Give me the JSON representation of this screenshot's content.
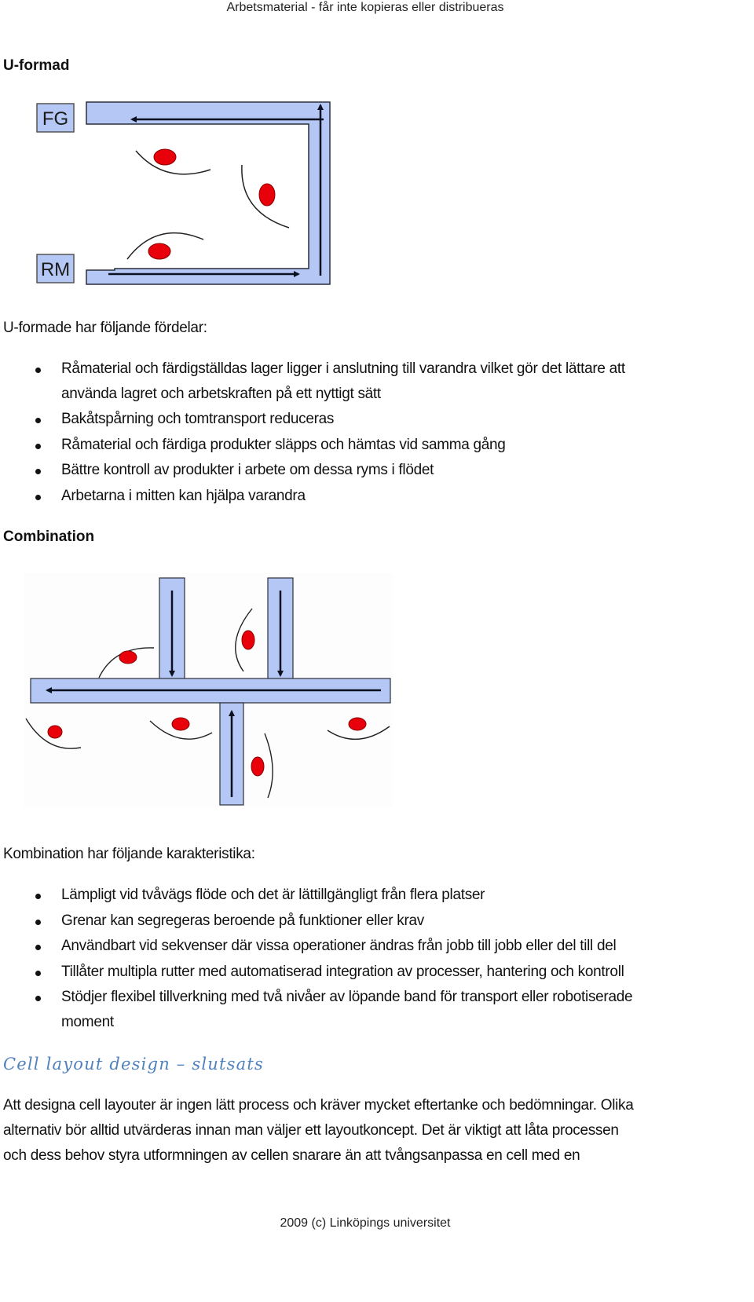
{
  "page": {
    "header": "Arbetsmaterial - får inte kopieras eller distribueras",
    "footer": "2009 (c) Linköpings universitet"
  },
  "u_section": {
    "heading": "U-formad",
    "diagram": {
      "labels": {
        "finished_goods": "FG",
        "raw_material": "RM"
      },
      "colors": {
        "conveyor_fill": "#B4C7F5",
        "conveyor_stroke": "#2B2F3A",
        "worker": "#E8000B",
        "arrow": "#0B1020"
      }
    },
    "intro": "U-formade har följande fördelar:",
    "bullets": [
      {
        "lines": [
          "Råmaterial och färdigställdas lager ligger i anslutning till varandra vilket gör det lättare att",
          "använda lagret och arbetskraften på ett nyttigt sätt"
        ]
      },
      {
        "lines": [
          "Bakåtspårning och tomtransport reduceras"
        ]
      },
      {
        "lines": [
          "Råmaterial och färdiga produkter släpps och hämtas vid samma gång"
        ]
      },
      {
        "lines": [
          "Bättre kontroll av produkter i arbete om dessa ryms i flödet"
        ]
      },
      {
        "lines": [
          "Arbetarna i mitten kan hjälpa varandra"
        ]
      }
    ]
  },
  "combination_section": {
    "heading": "Combination",
    "intro": "Kombination har följande karakteristika:",
    "bullets": [
      {
        "lines": [
          "Lämpligt vid tvåvägs flöde och det är lättillgängligt från flera platser"
        ]
      },
      {
        "lines": [
          "Grenar kan segregeras beroende på funktioner eller krav"
        ]
      },
      {
        "lines": [
          "Användbart vid sekvenser där vissa operationer ändras från jobb till jobb eller del till del"
        ]
      },
      {
        "lines": [
          "Tillåter multipla rutter med automatiserad integration av processer, hantering och kontroll"
        ]
      },
      {
        "lines": [
          "Stödjer flexibel tillverkning med två nivåer av löpande band för transport eller robotiserade",
          "moment"
        ]
      }
    ]
  },
  "conclusion_section": {
    "heading": "Cell layout design – slutsats",
    "paragraph_lines": [
      "Att designa cell layouter är ingen lätt process och kräver mycket eftertanke och bedömningar. Olika",
      "alternativ bör alltid utvärderas innan man väljer ett layoutkoncept. Det är viktigt att låta processen",
      "och dess behov styra utformningen av cellen snarare än att tvångsanpassa en cell med en"
    ]
  }
}
